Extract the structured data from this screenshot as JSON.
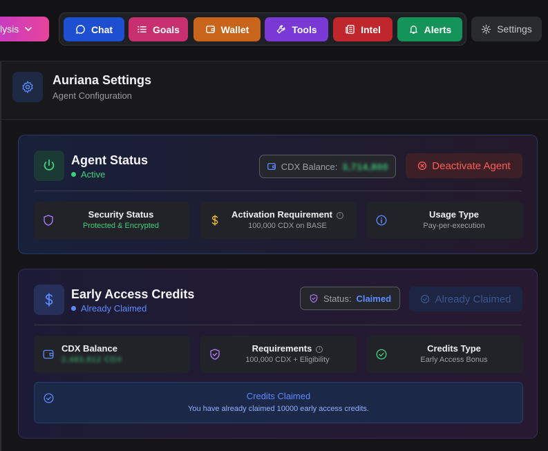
{
  "nav": {
    "analysis_label": "lysis",
    "chat_label": "Chat",
    "goals_label": "Goals",
    "wallet_label": "Wallet",
    "tools_label": "Tools",
    "intel_label": "Intel",
    "alerts_label": "Alerts",
    "settings_label": "Settings"
  },
  "colors": {
    "chat": "#1f4fd1",
    "goals": "#c72f6e",
    "wallet": "#c9651a",
    "tools": "#7a39d4",
    "intel": "#c0272d",
    "alerts": "#15945a",
    "active_green": "#3fd07b",
    "deactivate_red": "#ff5a5a",
    "claimed_blue": "#5b8cff"
  },
  "header": {
    "title": "Auriana Settings",
    "subtitle": "Agent Configuration"
  },
  "agent_status": {
    "title": "Agent Status",
    "state": "Active",
    "balance_label": "CDX Balance:",
    "balance_value": "3,714,800",
    "deactivate_label": "Deactivate Agent",
    "tiles": [
      {
        "title": "Security Status",
        "sub": "Protected & Encrypted"
      },
      {
        "title": "Activation Requirement",
        "sub": "100,000 CDX on BASE"
      },
      {
        "title": "Usage Type",
        "sub": "Pay-per-execution"
      }
    ]
  },
  "credits": {
    "title": "Early Access Credits",
    "state": "Already Claimed",
    "status_label": "Status:",
    "status_value": "Claimed",
    "claimed_button": "Already Claimed",
    "tiles": [
      {
        "title": "CDX Balance",
        "sub": "2,483,812 CDX"
      },
      {
        "title": "Requirements",
        "sub": "100,000 CDX + Eligibility"
      },
      {
        "title": "Credits Type",
        "sub": "Early Access Bonus"
      }
    ],
    "notice_title": "Credits Claimed",
    "notice_text": "You have already claimed 10000 early access credits."
  }
}
